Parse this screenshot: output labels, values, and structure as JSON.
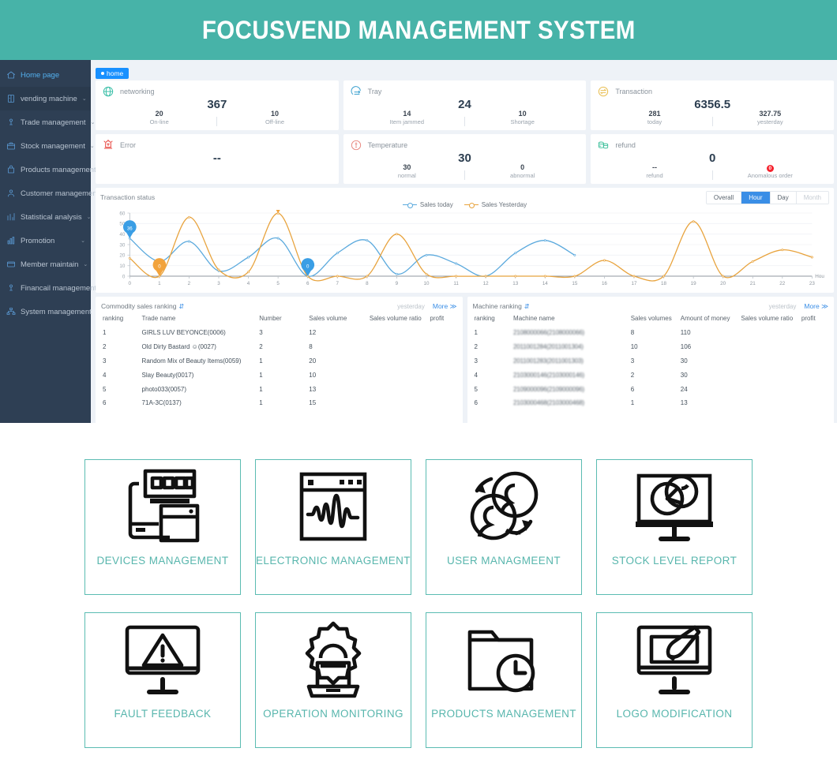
{
  "banner": {
    "title": "FOCUSVEND MANAGEMENT SYSTEM",
    "color": "#47b3a8"
  },
  "sidebar": {
    "items": [
      {
        "label": "Home page",
        "icon": "home-icon",
        "caret": "",
        "active": true
      },
      {
        "label": "vending machine",
        "icon": "machine-icon",
        "caret": "⌄"
      },
      {
        "label": "Trade management",
        "icon": "trade-icon",
        "caret": "⌄"
      },
      {
        "label": "Stock management",
        "icon": "stock-icon",
        "caret": "⌄"
      },
      {
        "label": "Products management",
        "icon": "products-icon",
        "caret": ""
      },
      {
        "label": "Customer management",
        "icon": "customer-icon",
        "caret": ""
      },
      {
        "label": "Statistical analysis",
        "icon": "chart-icon",
        "caret": "⌄"
      },
      {
        "label": "Promotion",
        "icon": "promotion-icon",
        "caret": "⌄"
      },
      {
        "label": "Member maintain",
        "icon": "member-icon",
        "caret": "⌄"
      },
      {
        "label": "Financail management",
        "icon": "finance-icon",
        "caret": ""
      },
      {
        "label": "System management",
        "icon": "system-icon",
        "caret": ""
      }
    ]
  },
  "tabs": {
    "home": "home"
  },
  "stat_cards": [
    {
      "title": "networking",
      "icon": "globe-icon",
      "main": "367",
      "left_value": "20",
      "left_label": "On-line",
      "right_value": "10",
      "right_label": "Off-line"
    },
    {
      "title": "Tray",
      "icon": "tray-icon",
      "main": "24",
      "left_value": "14",
      "left_label": "Item jammed",
      "right_value": "10",
      "right_label": "Shortage"
    },
    {
      "title": "Transaction",
      "icon": "transaction-icon",
      "main": "6356.5",
      "left_value": "281",
      "left_label": "today",
      "right_value": "327.75",
      "right_label": "yesterday"
    },
    {
      "title": "Error",
      "icon": "error-icon",
      "main": "--",
      "left_value": "",
      "left_label": "",
      "right_value": "",
      "right_label": ""
    },
    {
      "title": "Temperature",
      "icon": "temperature-icon",
      "main": "30",
      "left_value": "30",
      "left_label": "normal",
      "right_value": "0",
      "right_label": "abnormal"
    },
    {
      "title": "refund",
      "icon": "refund-icon",
      "main": "0",
      "left_value": "--",
      "left_label": "refund",
      "right_value": "0",
      "right_label": "Anomalous order"
    }
  ],
  "chart_panel": {
    "title": "Transaction status",
    "range_buttons": [
      {
        "label": "Overall",
        "state": "normal"
      },
      {
        "label": "Hour",
        "state": "active"
      },
      {
        "label": "Day",
        "state": "normal"
      },
      {
        "label": "Month",
        "state": "disabled"
      }
    ]
  },
  "chart_data": {
    "type": "line",
    "title": "Transaction status",
    "xlabel": "Hou",
    "ylabel": "",
    "ylim": [
      0,
      60
    ],
    "yticks": [
      0,
      10,
      20,
      30,
      40,
      50,
      60
    ],
    "x": [
      0,
      1,
      2,
      3,
      4,
      5,
      6,
      7,
      8,
      9,
      10,
      11,
      12,
      13,
      14,
      15,
      16,
      17,
      18,
      19,
      20,
      21,
      22,
      23
    ],
    "grid": true,
    "legend_position": "top-center",
    "series": [
      {
        "name": "Sales today",
        "color": "#5aa9dd",
        "values": [
          36,
          14,
          33,
          5,
          18,
          36,
          0,
          22,
          34,
          2,
          20,
          12,
          0,
          22,
          34,
          20,
          0,
          0,
          0,
          0,
          0,
          0,
          0,
          0
        ],
        "truncate_after": 15
      },
      {
        "name": "Sales Yesterday",
        "color": "#e8a33d",
        "values": [
          17,
          0,
          56,
          6,
          4,
          59.75,
          0,
          0,
          0,
          40,
          2,
          0,
          0,
          0,
          0,
          0,
          15,
          0,
          0,
          52,
          0,
          14,
          25,
          18
        ]
      }
    ],
    "annotations": [
      {
        "x": 0,
        "value": "36",
        "series": "Sales today",
        "color": "#3a9ee5"
      },
      {
        "x": 1,
        "value": "0",
        "series": "Sales Yesterday",
        "color": "#f2a33c"
      },
      {
        "x": 5,
        "value": "59.75",
        "series": "Sales Yesterday",
        "color": "#f2a33c"
      },
      {
        "x": 6,
        "value": "0",
        "series": "Sales today",
        "color": "#3a9ee5"
      }
    ]
  },
  "commodity_ranking": {
    "title": "Commodity sales ranking",
    "period": "yesterday",
    "more": "More ≫",
    "columns": [
      "ranking",
      "Trade name",
      "Number",
      "Sales volume",
      "Sales volume ratio",
      "profit"
    ],
    "rows": [
      [
        "1",
        "GIRLS LUV BEYONCE(0006)",
        "3",
        "12",
        "",
        ""
      ],
      [
        "2",
        "Old Dirty Bastard ☺(0027)",
        "2",
        "8",
        "",
        ""
      ],
      [
        "3",
        "Random Mix of Beauty Items(0059)",
        "1",
        "20",
        "",
        ""
      ],
      [
        "4",
        "Slay Beauty(0017)",
        "1",
        "10",
        "",
        ""
      ],
      [
        "5",
        "photo033(0057)",
        "1",
        "13",
        "",
        ""
      ],
      [
        "6",
        "71A-3C(0137)",
        "1",
        "15",
        "",
        ""
      ]
    ]
  },
  "machine_ranking": {
    "title": "Machine ranking",
    "period": "yesterday",
    "more": "More ≫",
    "columns": [
      "ranking",
      "Machine name",
      "Sales volumes",
      "Amount of money",
      "Sales volume ratio",
      "profit"
    ],
    "rows": [
      [
        "1",
        "2108000066(2108000066)",
        "8",
        "110",
        "",
        ""
      ],
      [
        "2",
        "2011001284(2011001304)",
        "10",
        "106",
        "",
        ""
      ],
      [
        "3",
        "2011001283(2011001303)",
        "3",
        "30",
        "",
        ""
      ],
      [
        "4",
        "2103000146(2103000146)",
        "2",
        "30",
        "",
        ""
      ],
      [
        "5",
        "2109000096(2109000096)",
        "6",
        "24",
        "",
        ""
      ],
      [
        "6",
        "2103000468(2103000468)",
        "1",
        "13",
        "",
        ""
      ]
    ]
  },
  "features": [
    {
      "label": "DEVICES MANAGEMENT",
      "icon": "devices-icon"
    },
    {
      "label": "ELECTRONIC MANAGEMENT",
      "icon": "waveform-window-icon"
    },
    {
      "label": "USER MANAGMEENT",
      "icon": "users-sync-icon"
    },
    {
      "label": "STOCK LEVEL REPORT",
      "icon": "monitor-pie-icon"
    },
    {
      "label": "FAULT FEEDBACK",
      "icon": "monitor-warning-icon"
    },
    {
      "label": "OPERATION MONITORING",
      "icon": "gear-laptop-icon"
    },
    {
      "label": "PRODUCTS MANAGEMENT",
      "icon": "folder-clock-icon"
    },
    {
      "label": "LOGO MODIFICATION",
      "icon": "monitor-brush-icon"
    }
  ]
}
